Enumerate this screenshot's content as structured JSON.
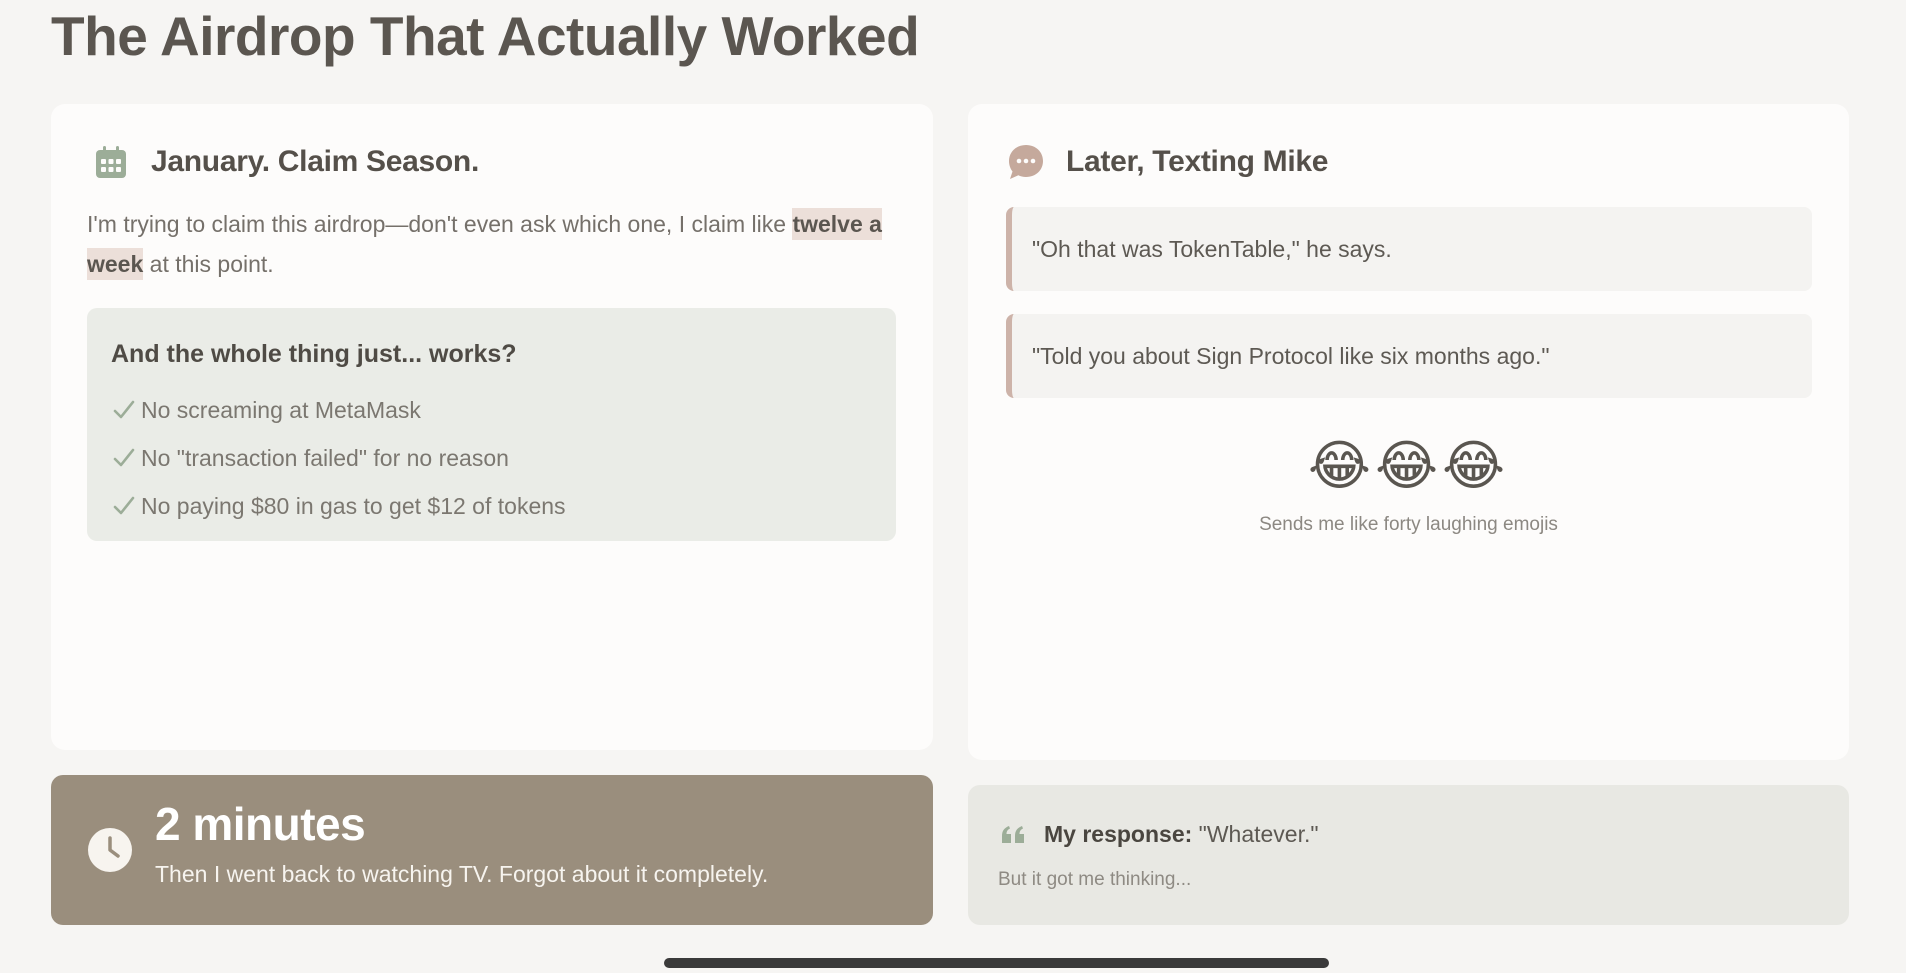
{
  "page": {
    "title": "The Airdrop That Actually Worked"
  },
  "left_card": {
    "icon": "calendar-icon",
    "heading": "January. Claim Season.",
    "intro_before": "I'm trying to claim this airdrop—don't even ask which one, I claim like ",
    "intro_highlight": "twelve a week",
    "intro_after": " at this point.",
    "works_box": {
      "heading": "And the whole thing just... works?",
      "items": [
        "No screaming at MetaMask",
        "No \"transaction failed\" for no reason",
        "No paying $80 in gas to get $12 of tokens"
      ]
    }
  },
  "right_card": {
    "icon": "speech-bubble-icon",
    "heading": "Later, Texting Mike",
    "quotes": [
      "\"Oh that was TokenTable,\" he says.",
      "\"Told you about Sign Protocol like six months ago.\""
    ],
    "emojis": "😂😂😂",
    "emoji_caption": "Sends me like forty laughing emojis"
  },
  "stat_card": {
    "icon": "clock-icon",
    "value": "2 minutes",
    "text": "Then I went back to watching TV. Forgot about it completely."
  },
  "response_card": {
    "icon": "quote-mark-icon",
    "label": "My response:",
    "response": " \"Whatever.\"",
    "subtext": "But it got me thinking..."
  },
  "colors": {
    "background": "#f6f5f3",
    "card": "#fdfcfb",
    "highlight": "#ecdfd9",
    "works_box": "#eaece7",
    "quote_border": "#cdb3a9",
    "stat_card": "#9a8e7d",
    "response_card": "#e8e8e3",
    "icon_green": "#9cad98",
    "icon_brown": "#c5a99c"
  }
}
